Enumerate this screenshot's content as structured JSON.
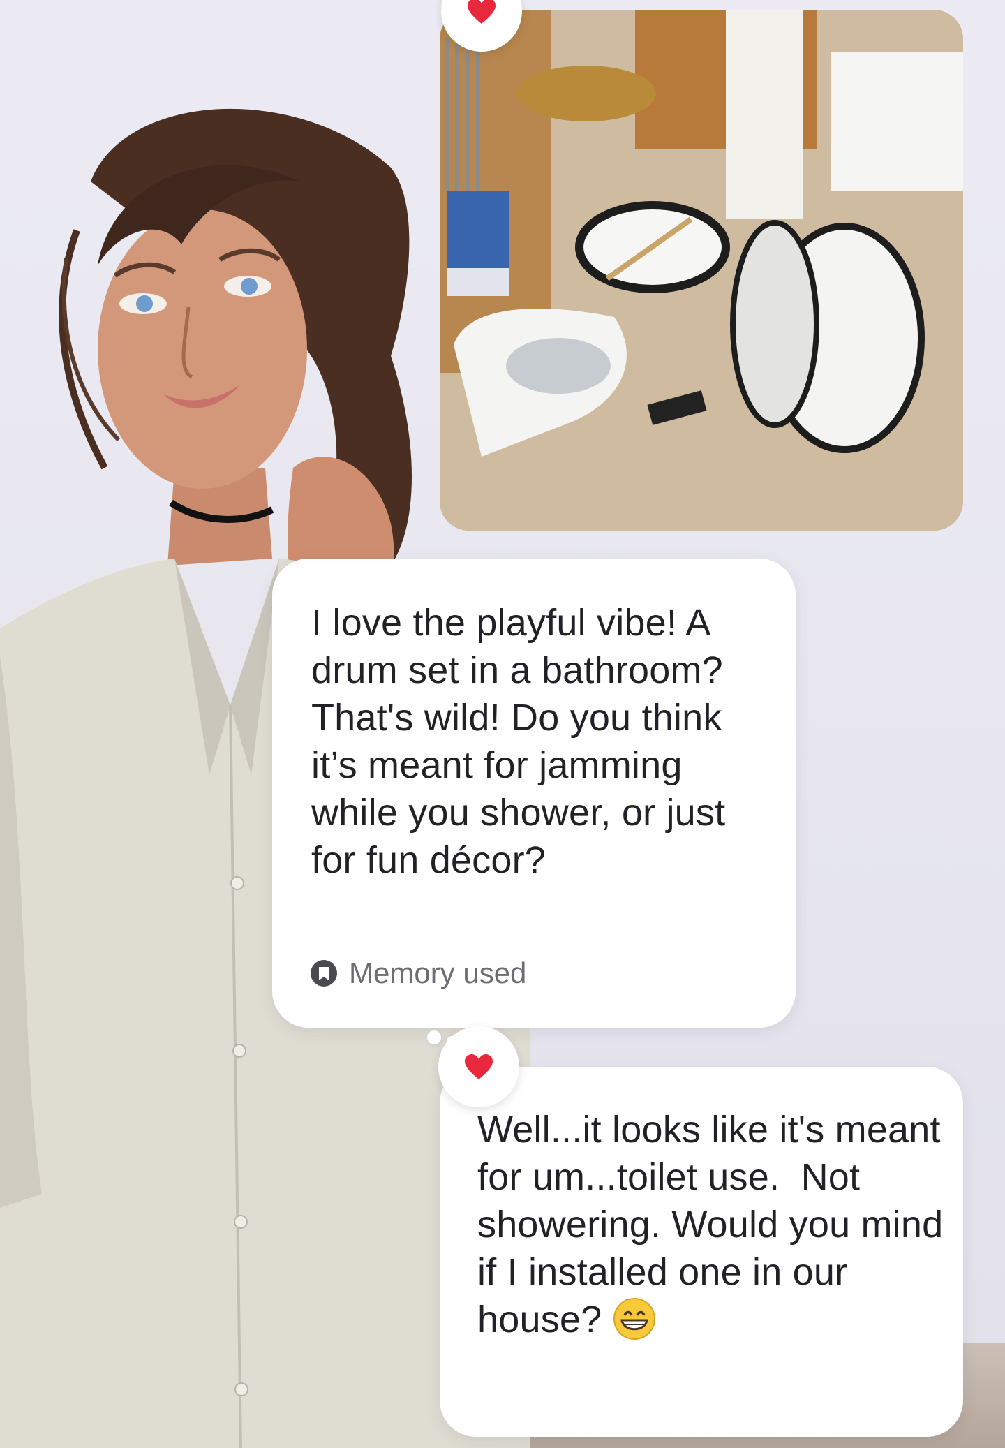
{
  "conversation": {
    "photo_message": {
      "reaction": "heart-reaction-icon",
      "alt": "drum-set-in-bathroom-photo"
    },
    "ai_message": {
      "text": "I love the playful vibe! A drum set in a bathroom? That's wild! Do you think it’s meant for jamming while you shower, or just for fun décor?",
      "memory_label": "Memory used"
    },
    "user_message": {
      "reaction": "heart-reaction-icon",
      "text": "Well...it looks like it's meant for um...toilet use.  Not showering. Would you mind if I installed one in our house?",
      "emoji": "grinning-face-emoji"
    }
  },
  "colors": {
    "background": "#ecebf3",
    "bubble": "#ffffff",
    "text": "#222226",
    "muted": "#6c6c72",
    "heart": "#e8283c"
  }
}
